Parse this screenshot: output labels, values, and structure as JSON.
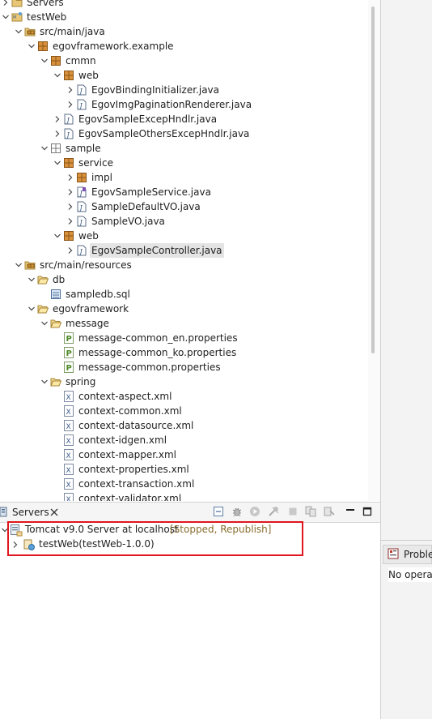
{
  "explorer": {
    "rows": [
      {
        "label": "Servers",
        "icon": "folder-icon",
        "chevron": "right"
      },
      {
        "label": "testWeb",
        "icon": "web-project-icon",
        "chevron": "down"
      },
      {
        "label": "src/main/java",
        "icon": "source-folder-icon",
        "chevron": "down"
      },
      {
        "label": "egovframework.example",
        "icon": "package-icon",
        "chevron": "down"
      },
      {
        "label": "cmmn",
        "icon": "package-icon",
        "chevron": "down"
      },
      {
        "label": "web",
        "icon": "package-icon",
        "chevron": "down"
      },
      {
        "label": "EgovBindingInitializer.java",
        "icon": "java-file-icon",
        "chevron": "right"
      },
      {
        "label": "EgovImgPaginationRenderer.java",
        "icon": "java-file-icon",
        "chevron": "right"
      },
      {
        "label": "EgovSampleExcepHndlr.java",
        "icon": "java-file-icon",
        "chevron": "right"
      },
      {
        "label": "EgovSampleOthersExcepHndlr.java",
        "icon": "java-file-icon",
        "chevron": "right"
      },
      {
        "label": "sample",
        "icon": "package-empty-icon",
        "chevron": "down"
      },
      {
        "label": "service",
        "icon": "package-icon",
        "chevron": "down"
      },
      {
        "label": "impl",
        "icon": "package-icon",
        "chevron": "right"
      },
      {
        "label": "EgovSampleService.java",
        "icon": "java-interface-icon",
        "chevron": "right"
      },
      {
        "label": "SampleDefaultVO.java",
        "icon": "java-file-icon",
        "chevron": "right"
      },
      {
        "label": "SampleVO.java",
        "icon": "java-file-icon",
        "chevron": "right"
      },
      {
        "label": "web",
        "icon": "package-icon",
        "chevron": "down"
      },
      {
        "label": "EgovSampleController.java",
        "icon": "java-file-icon",
        "chevron": "right"
      },
      {
        "label": "src/main/resources",
        "icon": "source-folder-icon",
        "chevron": "down"
      },
      {
        "label": "db",
        "icon": "folder-open-icon",
        "chevron": "down"
      },
      {
        "label": "sampledb.sql",
        "icon": "sql-file-icon",
        "chevron": ""
      },
      {
        "label": "egovframework",
        "icon": "folder-open-icon",
        "chevron": "down"
      },
      {
        "label": "message",
        "icon": "folder-open-icon",
        "chevron": "down"
      },
      {
        "label": "message-common_en.properties",
        "icon": "properties-file-icon",
        "chevron": ""
      },
      {
        "label": "message-common_ko.properties",
        "icon": "properties-file-icon",
        "chevron": ""
      },
      {
        "label": "message-common.properties",
        "icon": "properties-file-icon",
        "chevron": ""
      },
      {
        "label": "spring",
        "icon": "folder-open-icon",
        "chevron": "down"
      },
      {
        "label": "context-aspect.xml",
        "icon": "xml-file-icon",
        "chevron": ""
      },
      {
        "label": "context-common.xml",
        "icon": "xml-file-icon",
        "chevron": ""
      },
      {
        "label": "context-datasource.xml",
        "icon": "xml-file-icon",
        "chevron": ""
      },
      {
        "label": "context-idgen.xml",
        "icon": "xml-file-icon",
        "chevron": ""
      },
      {
        "label": "context-mapper.xml",
        "icon": "xml-file-icon",
        "chevron": ""
      },
      {
        "label": "context-properties.xml",
        "icon": "xml-file-icon",
        "chevron": ""
      },
      {
        "label": "context-transaction.xml",
        "icon": "xml-file-icon",
        "chevron": ""
      },
      {
        "label": "context-validator.xml",
        "icon": "xml-file-icon",
        "chevron": ""
      }
    ]
  },
  "servers_view": {
    "tab_label": "Servers",
    "server": {
      "name": "Tomcat v9.0 Server at localhost",
      "status": "[Stopped, Republish]"
    },
    "module": {
      "name": "testWeb(testWeb-1.0.0)"
    }
  },
  "problems_view": {
    "tab_label": "Problems",
    "message": "No operations to display at this time."
  },
  "colors": {
    "highlight_border": "#e0161f",
    "status_text": "#8a6d2e"
  }
}
